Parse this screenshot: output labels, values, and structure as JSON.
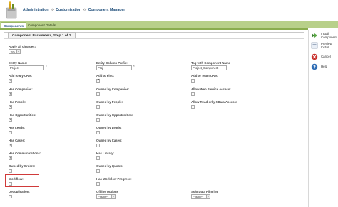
{
  "breadcrumb": {
    "items": [
      "Administration",
      "Customization",
      "Component Manager"
    ],
    "separator": "->"
  },
  "tabs": [
    {
      "label": "Components",
      "active": true
    },
    {
      "label": "Component Details",
      "active": false
    }
  ],
  "panel": {
    "title": "Component Parameters, Step 1 of 2"
  },
  "form": {
    "apply_all": {
      "label": "Apply all changes?",
      "value": "Yes"
    },
    "entity_name": {
      "label": "Entity Name:",
      "value": "Project",
      "required": "*"
    },
    "entity_prefix": {
      "label": "Entity Column Prefix:",
      "value": "Proj",
      "required": "*"
    },
    "tag": {
      "label": "Tag with Component Name",
      "value": "Project_Component"
    },
    "add_my_crm": {
      "label": "Add to My CRM:",
      "checked": true
    },
    "add_find": {
      "label": "Add to Find:",
      "checked": true
    },
    "add_team_crm": {
      "label": "Add to Team CRM:",
      "checked": false
    },
    "has_companies": {
      "label": "Has Companies:",
      "checked": true
    },
    "owned_companies": {
      "label": "Owned by Companies:",
      "checked": false
    },
    "allow_web_service": {
      "label": "Allow Web Service Access:",
      "checked": false
    },
    "has_people": {
      "label": "Has People:",
      "checked": true
    },
    "owned_people": {
      "label": "Owned by People:",
      "checked": false
    },
    "allow_sdata": {
      "label": "Allow Read-only SData Access:",
      "checked": false
    },
    "has_opportunities": {
      "label": "Has Opportunities:",
      "checked": true
    },
    "owned_opportunities": {
      "label": "Owned by Opportunities:",
      "checked": false
    },
    "has_leads": {
      "label": "Has Leads:",
      "checked": false
    },
    "owned_leads": {
      "label": "Owned by Leads:",
      "checked": false
    },
    "has_cases": {
      "label": "Has Cases:",
      "checked": true
    },
    "owned_cases": {
      "label": "Owned by Cases:",
      "checked": false
    },
    "has_communications": {
      "label": "Has Communications:",
      "checked": true
    },
    "has_library": {
      "label": "Has Library:",
      "checked": false
    },
    "owned_orders": {
      "label": "Owned by Orders:",
      "checked": false
    },
    "owned_quotes": {
      "label": "Owned by Quotes:",
      "checked": false
    },
    "workflow": {
      "label": "Workflow:",
      "checked": false
    },
    "has_workflow_progress": {
      "label": "Has Workflow Progress:",
      "checked": false
    },
    "deduplication": {
      "label": "Deduplication:",
      "checked": false
    },
    "offline_options": {
      "label": "Offline Options",
      "value": "--None--"
    },
    "solo_filtering": {
      "label": "Solo Data Filtering",
      "value": "--None--"
    }
  },
  "actions": [
    {
      "label_line1": "Install",
      "label_line2": "Component",
      "icon": "install-icon"
    },
    {
      "label_line1": "Preview",
      "label_line2": "Install",
      "icon": "preview-icon"
    },
    {
      "label_line1": "Cancel",
      "label_line2": "",
      "icon": "cancel-icon"
    },
    {
      "label_line1": "Help",
      "label_line2": "",
      "icon": "help-icon"
    }
  ],
  "colors": {
    "tabbar": "#b8d08a",
    "breadcrumb": "#1f4e7a",
    "highlight": "#d03a3a"
  }
}
